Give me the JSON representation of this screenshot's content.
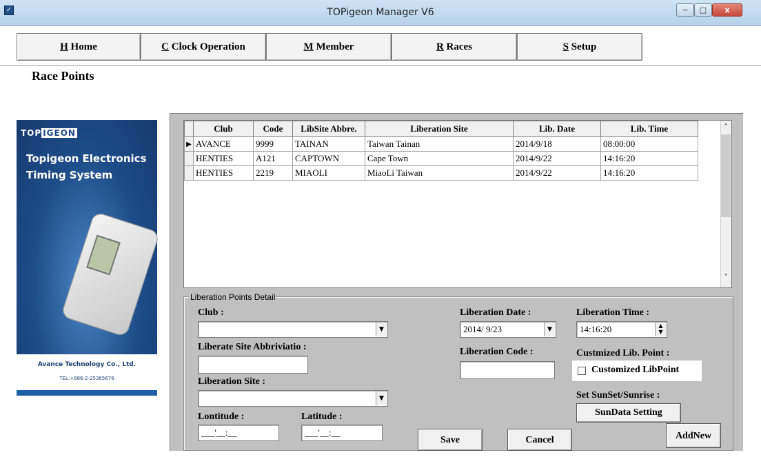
{
  "window": {
    "title": "TOPigeon Manager V6",
    "app_icon": "app-icon",
    "minimize": "−",
    "maximize": "□",
    "close": "x"
  },
  "menu": [
    {
      "key": "H",
      "label": "Home"
    },
    {
      "key": "C",
      "label": "Clock Operation"
    },
    {
      "key": "M",
      "label": "Member"
    },
    {
      "key": "R",
      "label": "Races"
    },
    {
      "key": "S",
      "label": "Setup"
    }
  ],
  "page_title": "Race Points",
  "brand": {
    "logo_prefix": "TOP",
    "logo_suffix": "IGEON",
    "name_line1": "Topigeon Electronics",
    "name_line2": "Timing System",
    "company": "Avance Technology Co., Ltd.",
    "tel": "TEL:+886-2-25385676"
  },
  "grid": {
    "columns": [
      "Club",
      "Code",
      "LibSite Abbre.",
      "Liberation Site",
      "Lib. Date",
      "Lib. Time"
    ],
    "rows": [
      [
        "AVANCE",
        "9999",
        "TAINAN",
        "Taiwan Tainan",
        "2014/9/18",
        "08:00:00"
      ],
      [
        "HENTIES",
        "A121",
        "CAPTOWN",
        "Cape Town",
        "2014/9/22",
        "14:16:20"
      ],
      [
        "HENTIES",
        "2219",
        "MIAOLI",
        "MiaoLi Taiwan",
        "2014/9/22",
        "14:16:20"
      ]
    ],
    "current_row_marker": "▶"
  },
  "detail": {
    "legend": "Liberation Points Detail",
    "club_label": "Club :",
    "club_value": "",
    "abbr_label": "Liberate Site Abbriviatio :",
    "abbr_value": "",
    "site_label": "Liberation Site :",
    "site_value": "",
    "lon_label": "Lontitude :",
    "lon_value": "___'__:__",
    "lat_label": "Latitude :",
    "lat_value": "___'__:__",
    "date_label": "Liberation Date :",
    "date_value": "2014/ 9/23",
    "code_label": "Liberation Code :",
    "code_value": "",
    "time_label": "Liberation Time :",
    "time_value": "14:16:20",
    "custom_label": "Custmized Lib. Point :",
    "custom_checkbox_label": "Customized LibPoint",
    "custom_checked": false,
    "sun_label": "Set SunSet/Sunrise :",
    "sun_button": "SunData Setting",
    "save_button": "Save",
    "cancel_button": "Cancel",
    "addnew_button": "AddNew"
  }
}
